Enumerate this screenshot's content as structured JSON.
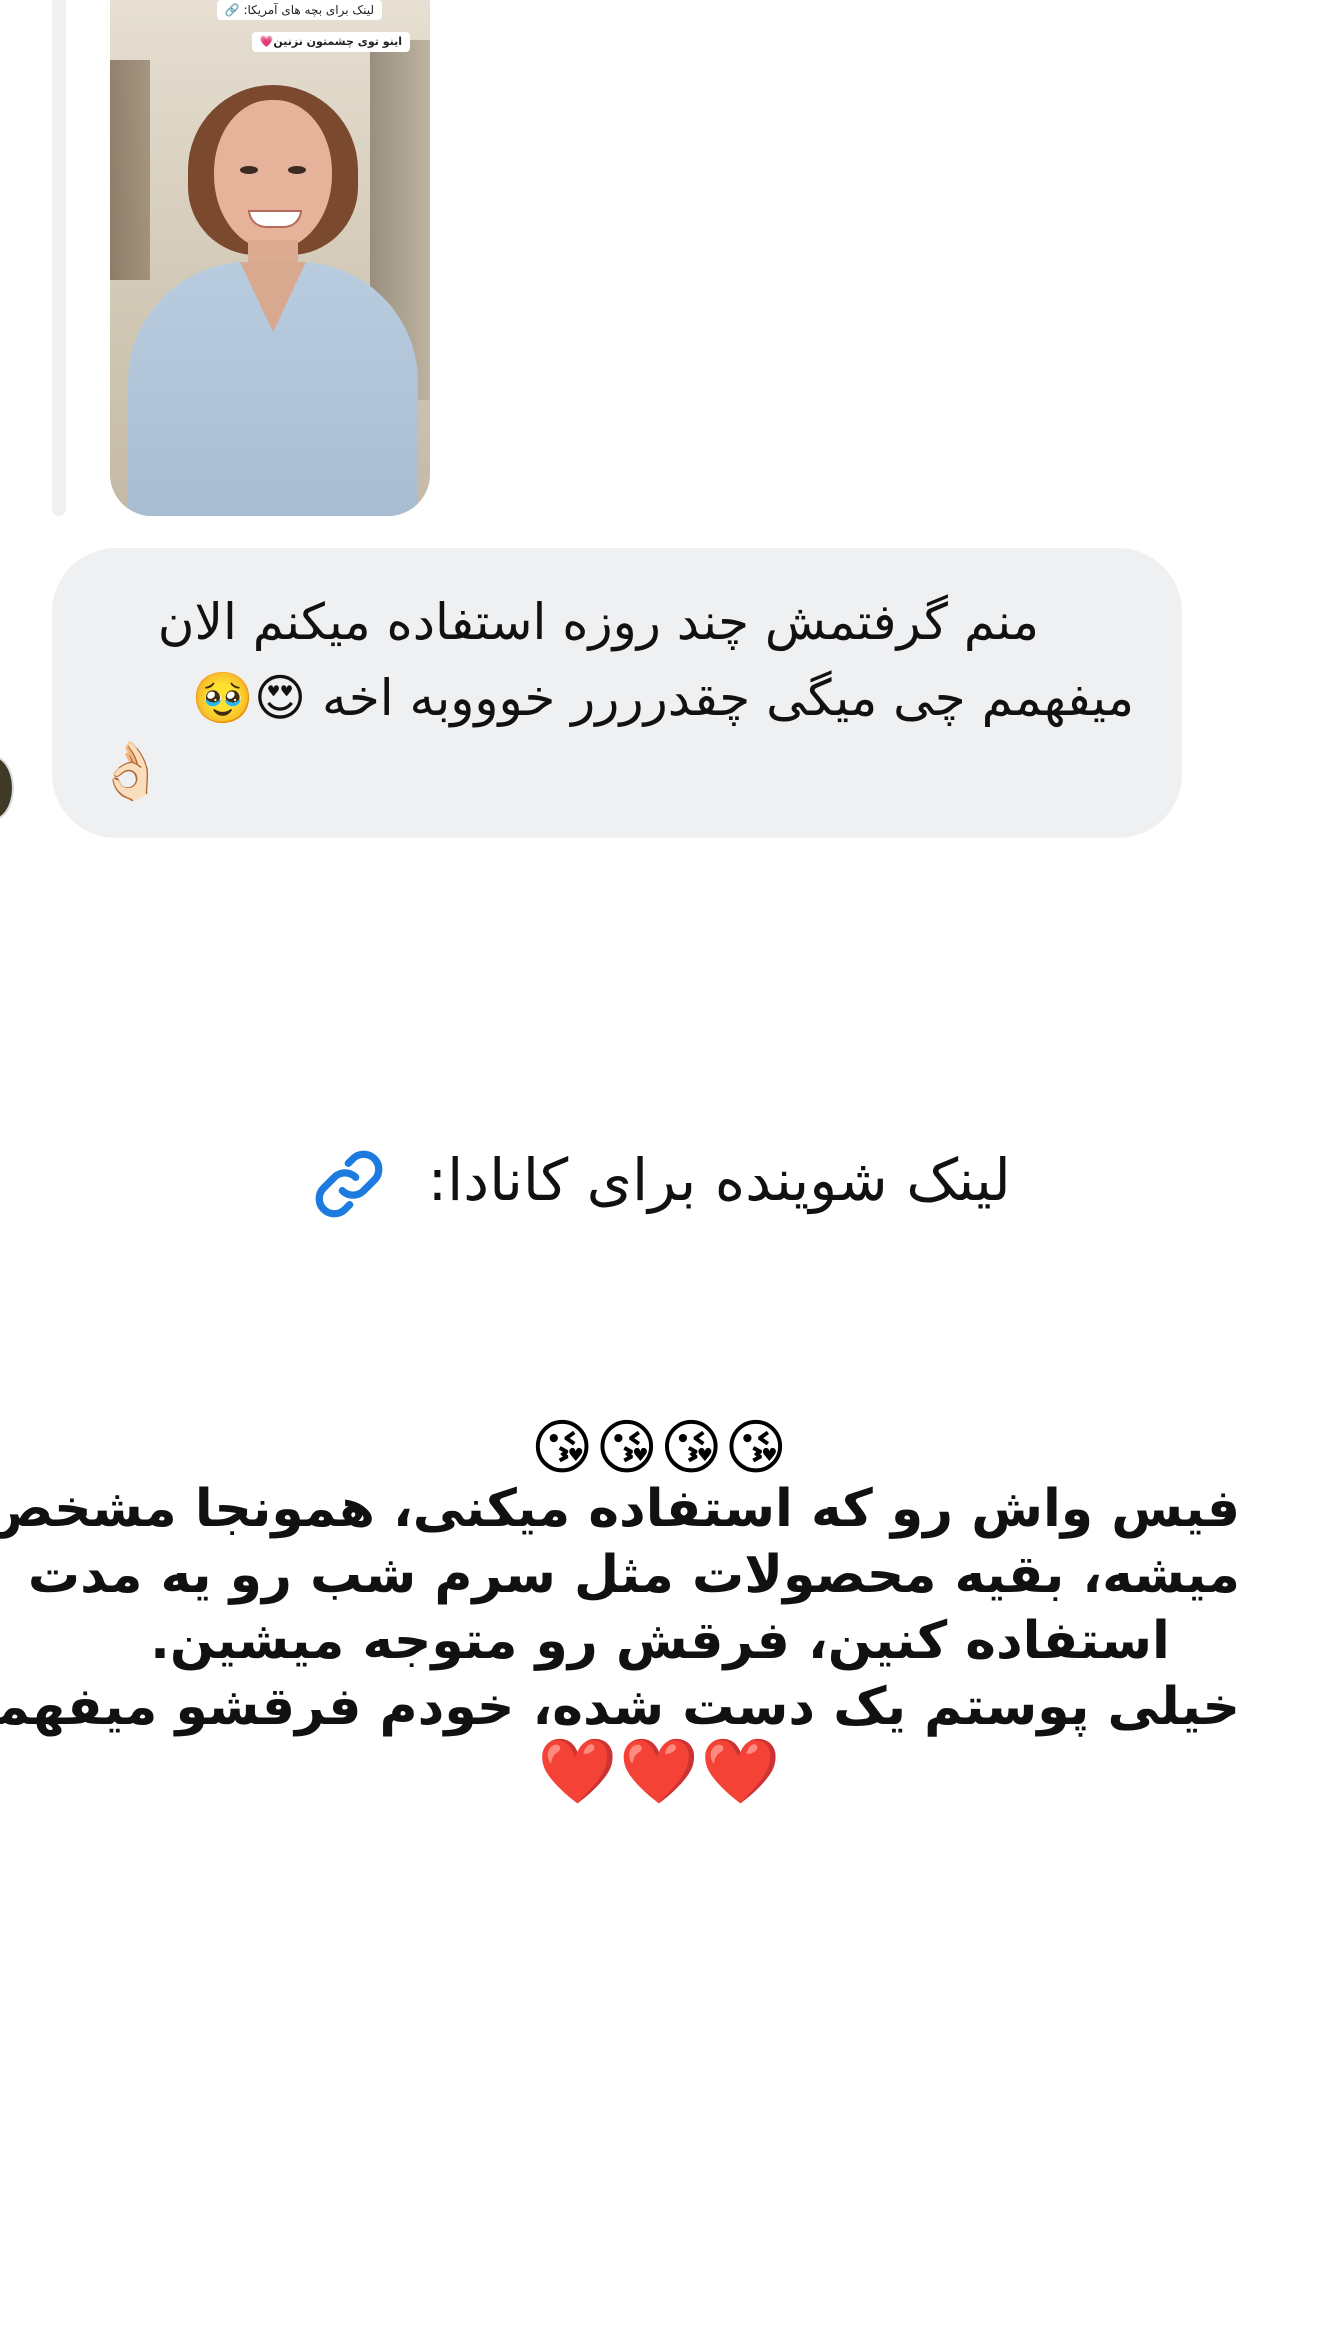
{
  "story_preview": {
    "tag_top": "لینک برای بچه های آمریکا:",
    "tag_bottom": "اینو توی چشمتون نزنین💗"
  },
  "message": {
    "line1": "منم گرفتمش چند روزه استفاده میکنم الان",
    "line2": "میفهمم چی میگی چقدرررر خوووبه اخه 😍🥹",
    "line3_emoji": "👌🏻"
  },
  "link_caption": "لینک شوینده برای کانادا:",
  "emoji_row": "😘😘😘😘",
  "caption": {
    "line1": "فیس واش رو که استفاده میکنی، همونجا مشخص",
    "line2": "میشه، بقیه محصولات مثل سرم شب رو یه مدت",
    "line3": "استفاده کنین، فرقش رو متوجه میشین.",
    "line4": "خیلی پوستم یک دست شده، خودم فرقشو میفهمم"
  },
  "hearts_row": "❤️❤️❤️",
  "colors": {
    "bubble_bg": "#eff0f2",
    "link_icon": "#1d7be0",
    "text": "#111111"
  }
}
